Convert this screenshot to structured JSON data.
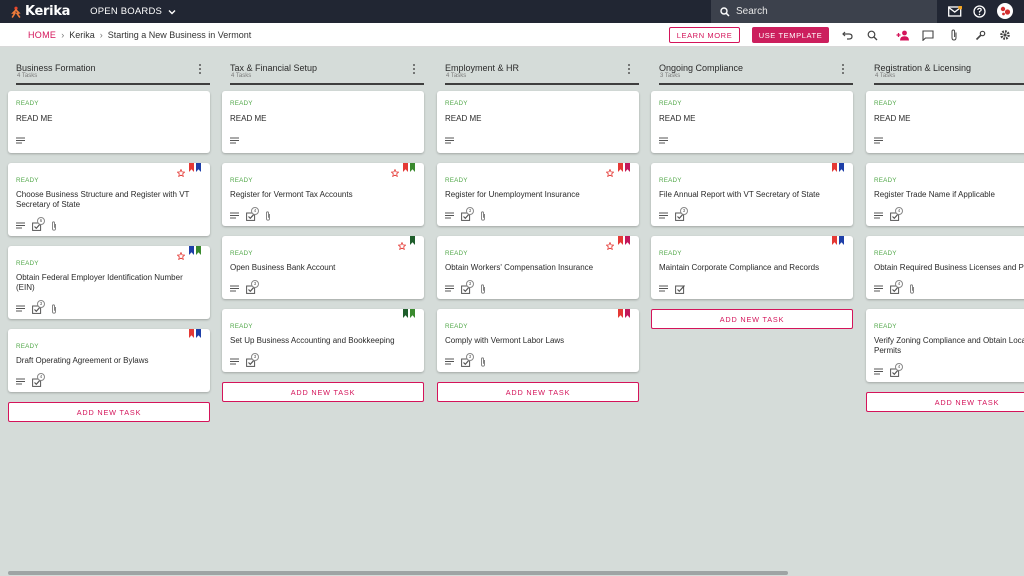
{
  "app": {
    "name": "Kerika",
    "open_boards": "OPEN BOARDS",
    "search_placeholder": "Search"
  },
  "breadcrumb": {
    "home": "HOME",
    "account": "Kerika",
    "board": "Starting a New Business in Vermont"
  },
  "toolbar": {
    "learn_more": "LEARN MORE",
    "use_template": "USE TEMPLATE"
  },
  "colors": {
    "accent": "#d4145a",
    "ready": "#52a84a",
    "red_flag": "#e53935",
    "blue_flag": "#1e3fa8",
    "green_flag": "#3a8a2e",
    "dark_green_flag": "#1f5e2c",
    "crimson_flag": "#c2185b"
  },
  "add_task_label": "ADD NEW TASK",
  "columns": [
    {
      "title": "Business Formation",
      "count": "4 Tasks",
      "cards": [
        {
          "status": "READY",
          "title": "READ ME",
          "badge": null,
          "attach": false,
          "star": false,
          "flags": []
        },
        {
          "status": "READY",
          "title": "Choose Business Structure and Register with VT Secretary of State",
          "badge": "6",
          "attach": true,
          "star": true,
          "flags": [
            "red_flag",
            "blue_flag"
          ]
        },
        {
          "status": "READY",
          "title": "Obtain Federal Employer Identification Number (EIN)",
          "badge": "3",
          "attach": true,
          "star": true,
          "flags": [
            "blue_flag",
            "green_flag"
          ]
        },
        {
          "status": "READY",
          "title": "Draft Operating Agreement or Bylaws",
          "badge": "4",
          "attach": false,
          "star": false,
          "flags": [
            "red_flag",
            "blue_flag"
          ]
        }
      ]
    },
    {
      "title": "Tax & Financial Setup",
      "count": "4 Tasks",
      "cards": [
        {
          "status": "READY",
          "title": "READ ME",
          "badge": null,
          "attach": false,
          "star": false,
          "flags": []
        },
        {
          "status": "READY",
          "title": "Register for Vermont Tax Accounts",
          "badge": "4",
          "attach": true,
          "star": true,
          "flags": [
            "red_flag",
            "green_flag"
          ]
        },
        {
          "status": "READY",
          "title": "Open Business Bank Account",
          "badge": "3",
          "attach": false,
          "star": true,
          "flags": [
            "dark_green_flag"
          ]
        },
        {
          "status": "READY",
          "title": "Set Up Business Accounting and Bookkeeping",
          "badge": "3",
          "attach": false,
          "star": false,
          "flags": [
            "dark_green_flag",
            "green_flag"
          ]
        }
      ]
    },
    {
      "title": "Employment & HR",
      "count": "4 Tasks",
      "cards": [
        {
          "status": "READY",
          "title": "READ ME",
          "badge": null,
          "attach": false,
          "star": false,
          "flags": []
        },
        {
          "status": "READY",
          "title": "Register for Unemployment Insurance",
          "badge": "3",
          "attach": true,
          "star": true,
          "flags": [
            "red_flag",
            "crimson_flag"
          ]
        },
        {
          "status": "READY",
          "title": "Obtain Workers' Compensation Insurance",
          "badge": "3",
          "attach": true,
          "star": true,
          "flags": [
            "red_flag",
            "crimson_flag"
          ]
        },
        {
          "status": "READY",
          "title": "Comply with Vermont Labor Laws",
          "badge": "3",
          "attach": true,
          "star": false,
          "flags": [
            "red_flag",
            "crimson_flag"
          ]
        }
      ]
    },
    {
      "title": "Ongoing Compliance",
      "count": "3 Tasks",
      "cards": [
        {
          "status": "READY",
          "title": "READ ME",
          "badge": null,
          "attach": false,
          "star": false,
          "flags": []
        },
        {
          "status": "READY",
          "title": "File Annual Report with VT Secretary of State",
          "badge": "3",
          "attach": false,
          "star": false,
          "flags": [
            "red_flag",
            "blue_flag"
          ]
        },
        {
          "status": "READY",
          "title": "Maintain Corporate Compliance and Records",
          "badge": null,
          "attach": false,
          "star": false,
          "flags": [
            "red_flag",
            "blue_flag"
          ]
        }
      ]
    },
    {
      "title": "Registration & Licensing",
      "count": "4 Tasks",
      "cards": [
        {
          "status": "READY",
          "title": "READ ME",
          "badge": null,
          "attach": false,
          "star": false,
          "flags": []
        },
        {
          "status": "READY",
          "title": "Register Trade Name if Applicable",
          "badge": "4",
          "attach": false,
          "star": false,
          "flags": []
        },
        {
          "status": "READY",
          "title": "Obtain Required Business Licenses and Permits",
          "badge": "4",
          "attach": true,
          "star": false,
          "flags": []
        },
        {
          "status": "READY",
          "title": "Verify Zoning Compliance and Obtain Local Permits",
          "badge": "4",
          "attach": false,
          "star": false,
          "flags": []
        }
      ]
    }
  ]
}
